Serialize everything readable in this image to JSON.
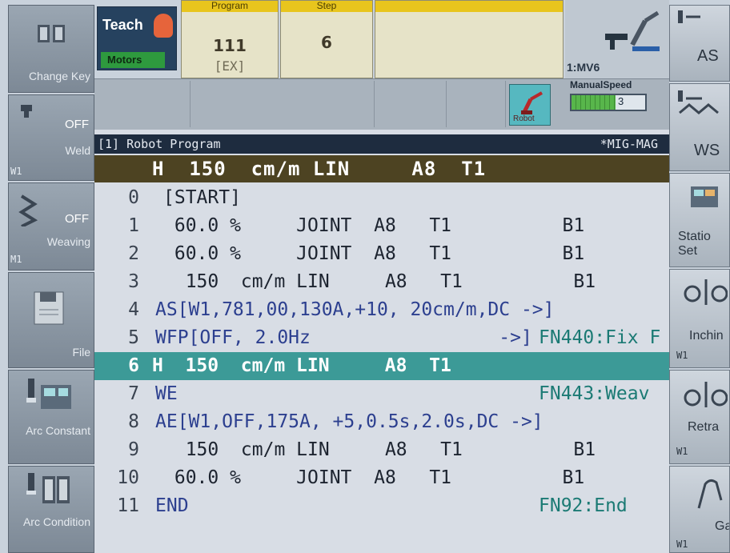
{
  "left_keys": [
    {
      "label": "Change Key",
      "icon": "book-icon"
    },
    {
      "state": "OFF",
      "label": "Weld",
      "tag": "W1",
      "icon": "torch-icon"
    },
    {
      "state": "OFF",
      "label": "Weaving",
      "tag": "M1",
      "icon": "weave-icon"
    },
    {
      "label": "File",
      "icon": "floppy-disk-icon"
    },
    {
      "label": "Arc Constant",
      "icon": "arc-constant-icon"
    },
    {
      "label": "Arc Condition",
      "icon": "arc-condition-icon"
    }
  ],
  "right_keys": [
    {
      "label": "AS",
      "icon": "arc-start-icon"
    },
    {
      "label": "WS",
      "icon": "weave-start-icon"
    },
    {
      "label": "Statio Set",
      "icon": "station-icon"
    },
    {
      "label": "Inchin",
      "tag": "W1",
      "icon": "inching-icon"
    },
    {
      "label": "Retra",
      "tag": "W1",
      "icon": "retract-icon"
    },
    {
      "label": "Ga",
      "tag": "W1",
      "icon": "gas-icon"
    }
  ],
  "status": {
    "mode": "Teach",
    "motors": "Motors",
    "program_header": "Program",
    "program_number": "111",
    "program_sub": "[EX]",
    "step_header": "Step",
    "step_value": "6",
    "mechanism": "1:MV6",
    "robot_button": "Robot",
    "manual_speed_label": "ManualSpeed",
    "manual_speed_value": "3",
    "manual_speed_fraction": 0.6
  },
  "program": {
    "title": "[1] Robot Program",
    "process": "*MIG-MAG",
    "current_line": "H  150  cm/m LIN     A8  T1",
    "lines": [
      {
        "n": "0",
        "text": "[START]"
      },
      {
        "n": "1",
        "text": " 60.0 %     JOINT  A8   T1          B1"
      },
      {
        "n": "2",
        "text": " 60.0 %     JOINT  A8   T1          B1"
      },
      {
        "n": "3",
        "text": "  150  cm/m LIN     A8   T1          B1"
      },
      {
        "n": "4",
        "text": "AS[W1,781,00,130A,+10, 20cm/m,DC ->]"
      },
      {
        "n": "5",
        "text": "WFP[OFF, 2.0Hz                 ->]",
        "comment": "FN440:Fix F"
      },
      {
        "n": "6",
        "text": "H  150  cm/m LIN     A8  T1"
      },
      {
        "n": "7",
        "text": "WE",
        "comment": "FN443:Weav"
      },
      {
        "n": "8",
        "text": "AE[W1,OFF,175A, +5,0.5s,2.0s,DC ->]"
      },
      {
        "n": "9",
        "text": "  150  cm/m LIN     A8   T1          B1"
      },
      {
        "n": "10",
        "text": " 60.0 %     JOINT  A8   T1          B1"
      },
      {
        "n": "11",
        "text": "END",
        "comment": "FN92:End"
      }
    ]
  }
}
